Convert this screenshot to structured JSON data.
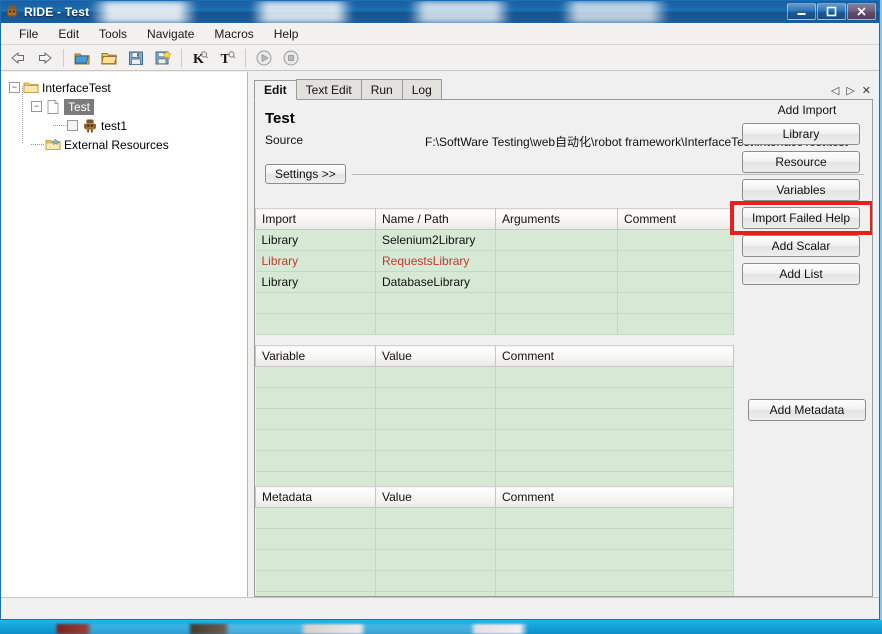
{
  "window": {
    "title": "RIDE - Test",
    "app_icon": "robot-icon",
    "minimize_label": "–",
    "maximize_label": "❐",
    "close_label": "✕"
  },
  "menu": {
    "items": [
      {
        "label": "File"
      },
      {
        "label": "Edit"
      },
      {
        "label": "Tools"
      },
      {
        "label": "Navigate"
      },
      {
        "label": "Macros"
      },
      {
        "label": "Help"
      }
    ]
  },
  "toolbar": {
    "buttons": [
      {
        "name": "back-icon",
        "glyph": "⇦",
        "title": "Back"
      },
      {
        "name": "forward-icon",
        "glyph": "⇨",
        "title": "Forward"
      },
      {
        "name": "new-project-icon",
        "glyph": "🗀",
        "title": "New Project"
      },
      {
        "name": "open-folder-icon",
        "glyph": "🗁",
        "title": "Open Directory"
      },
      {
        "name": "save-icon",
        "glyph": "💾",
        "title": "Save"
      },
      {
        "name": "save-all-icon",
        "glyph": "💾",
        "title": "Save All"
      },
      {
        "name": "search-keyword-icon",
        "glyph": "K",
        "title": "Search Keywords"
      },
      {
        "name": "search-tag-icon",
        "glyph": "T",
        "title": "Search Tags"
      },
      {
        "name": "run-icon",
        "glyph": "▶",
        "title": "Run"
      },
      {
        "name": "stop-icon",
        "glyph": "■",
        "title": "Stop"
      }
    ]
  },
  "tree": {
    "nodes": [
      {
        "label": "InterfaceTest",
        "icon": "folder-icon",
        "expander": "−",
        "selected": false,
        "checkbox": false,
        "depth": 0
      },
      {
        "label": "Test",
        "icon": "file-icon",
        "expander": "−",
        "selected": true,
        "checkbox": false,
        "depth": 1
      },
      {
        "label": "test1",
        "icon": "robot-icon",
        "expander": "",
        "selected": false,
        "checkbox": true,
        "depth": 2
      },
      {
        "label": "External Resources",
        "icon": "folder-resource-icon",
        "expander": "",
        "selected": false,
        "checkbox": false,
        "depth": 1
      }
    ]
  },
  "tabs": {
    "items": [
      {
        "label": "Edit",
        "active": true
      },
      {
        "label": "Text Edit",
        "active": false
      },
      {
        "label": "Run",
        "active": false
      },
      {
        "label": "Log",
        "active": false
      }
    ],
    "nav": {
      "prev": "◁",
      "next": "▷",
      "close": "✕"
    }
  },
  "editor": {
    "title": "Test",
    "source_label": "Source",
    "source_value": "F:\\SoftWare Testing\\web自动化\\robot framework\\InterfaceTest\\InterfaceTest\\test",
    "settings_button": "Settings >>"
  },
  "import_grid": {
    "headers": [
      "Import",
      "Name / Path",
      "Arguments",
      "Comment"
    ],
    "rows": [
      {
        "cells": [
          "Library",
          "Selenium2Library",
          "",
          ""
        ],
        "failed": false
      },
      {
        "cells": [
          "Library",
          "RequestsLibrary",
          "",
          ""
        ],
        "failed": true
      },
      {
        "cells": [
          "Library",
          "DatabaseLibrary",
          "",
          ""
        ],
        "failed": false
      },
      {
        "cells": [
          "",
          "",
          "",
          ""
        ],
        "failed": false
      },
      {
        "cells": [
          "",
          "",
          "",
          ""
        ],
        "failed": false
      }
    ]
  },
  "variable_grid": {
    "headers": [
      "Variable",
      "Value",
      "Comment"
    ],
    "rows": [
      {
        "cells": [
          "",
          "",
          ""
        ]
      },
      {
        "cells": [
          "",
          "",
          ""
        ]
      },
      {
        "cells": [
          "",
          "",
          ""
        ]
      },
      {
        "cells": [
          "",
          "",
          ""
        ]
      },
      {
        "cells": [
          "",
          "",
          ""
        ]
      },
      {
        "cells": [
          "",
          "",
          ""
        ]
      }
    ]
  },
  "metadata_grid": {
    "headers": [
      "Metadata",
      "Value",
      "Comment"
    ],
    "rows": [
      {
        "cells": [
          "",
          "",
          ""
        ]
      },
      {
        "cells": [
          "",
          "",
          ""
        ]
      },
      {
        "cells": [
          "",
          "",
          ""
        ]
      },
      {
        "cells": [
          "",
          "",
          ""
        ]
      },
      {
        "cells": [
          "",
          "",
          ""
        ]
      }
    ]
  },
  "side_panel": {
    "add_import_label": "Add Import",
    "buttons": [
      {
        "label": "Library",
        "name": "add-library-button",
        "highlighted": false
      },
      {
        "label": "Resource",
        "name": "add-resource-button",
        "highlighted": false
      },
      {
        "label": "Variables",
        "name": "add-variables-button",
        "highlighted": false
      },
      {
        "label": "Import Failed Help",
        "name": "import-failed-help-button",
        "highlighted": true
      },
      {
        "label": "Add Scalar",
        "name": "add-scalar-button",
        "highlighted": false
      },
      {
        "label": "Add List",
        "name": "add-list-button",
        "highlighted": false
      }
    ],
    "add_metadata_label": "Add Metadata"
  },
  "colors": {
    "grid_row_bg": "#d6e9d4",
    "failed_text": "#c0392b",
    "highlight_border": "#e8201b",
    "title_bar": "#1a6fb4",
    "selection": "#7b7b7b"
  }
}
